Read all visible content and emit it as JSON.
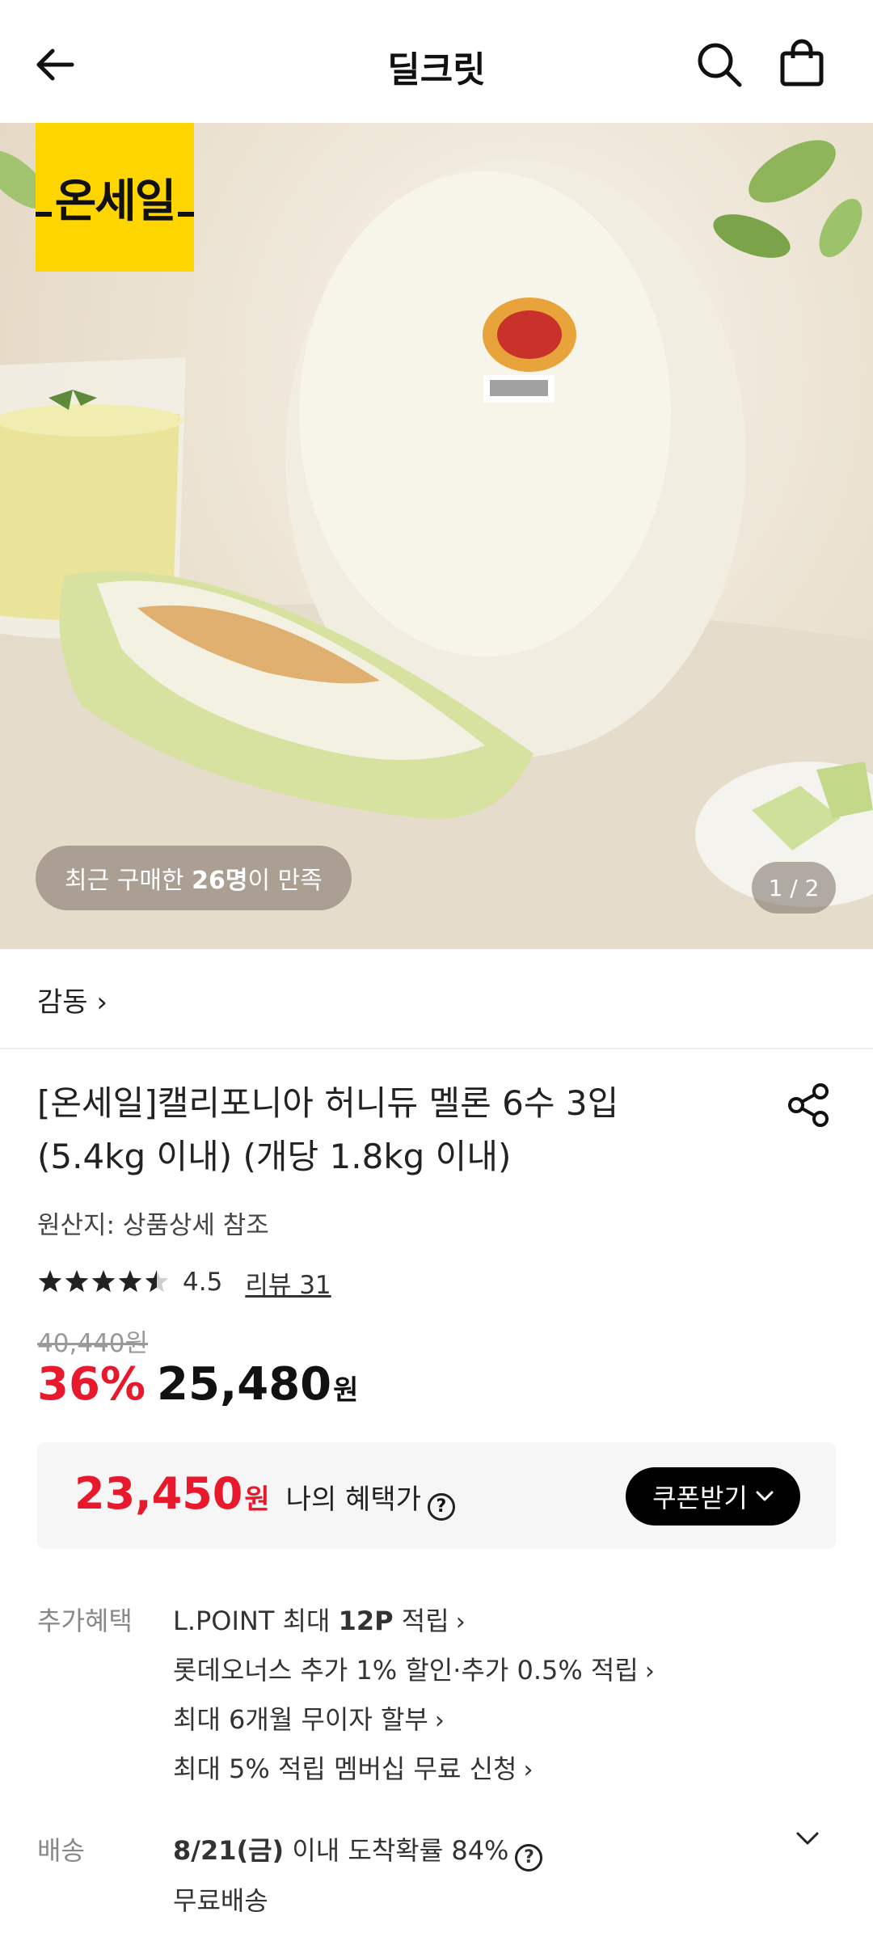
{
  "header": {
    "title": "딜크릿"
  },
  "hero": {
    "badge_text": "온세일",
    "satisfy_prefix": "최근 구매한 ",
    "satisfy_count": "26명",
    "satisfy_suffix": "이 만족",
    "page_indicator": "1 / 2"
  },
  "product": {
    "brand": "감동 ›",
    "title_line1": "[온세일]캘리포니아 허니듀 멜론 6수 3입",
    "title_line2": "(5.4kg 이내) (개당 1.8kg 이내)",
    "origin": "원산지: 상품상세 참조",
    "rating": "4.5",
    "rating_fraction": 0.9,
    "review": "리뷰 31",
    "original_price": "40,440원",
    "discount": "36%",
    "price": "25,480",
    "won": "원"
  },
  "benefit_box": {
    "price": "23,450",
    "won": "원",
    "label": "나의 혜택가",
    "coupon_label": "쿠폰받기"
  },
  "extra": {
    "label": "추가혜택",
    "line1_pre": "L.POINT 최대 ",
    "line1_bold": "12P",
    "line1_post": " 적립",
    "line2": "롯데오너스 추가 1% 할인·추가 0.5% 적립",
    "line3": "최대 6개월 무이자 할부",
    "line4": "최대 5% 적립 멤버십 무료 신청"
  },
  "delivery": {
    "label": "배송",
    "date": "8/21(금)",
    "text": " 이내 도착확률 84%",
    "fee": "무료배송"
  },
  "colors": {
    "accent_red": "#e8192c",
    "badge_yellow": "#ffd500"
  },
  "icons": [
    "back-arrow-icon",
    "search-icon",
    "shopping-bag-icon",
    "share-icon",
    "question-icon",
    "chevron-down-icon"
  ]
}
